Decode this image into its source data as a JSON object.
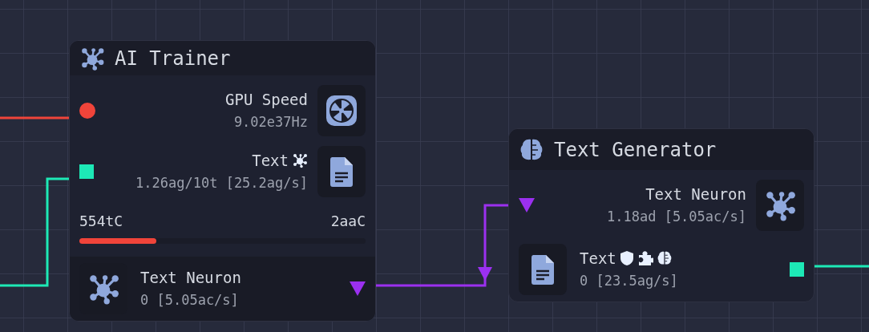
{
  "nodes": [
    {
      "kind": "trainer",
      "title": "AI Trainer",
      "rows": [
        {
          "kind": "gpu",
          "label": "GPU Speed",
          "value": "9.02e37Hz",
          "port": {
            "kind": "circle",
            "color": "#f0443a"
          }
        },
        {
          "kind": "text",
          "label": "Text",
          "value": "1.26ag/10t [25.2ag/s]",
          "port": {
            "kind": "square",
            "color": "#1de9b6"
          },
          "badges": [
            {
              "kind": "neuron"
            }
          ]
        }
      ],
      "progress": {
        "start": "554tC",
        "end": "2aaC",
        "level": 0.27
      },
      "outputs": [
        {
          "kind": "neuron",
          "label": "Text Neuron",
          "value": "0 [5.05ac/s]",
          "port": {
            "kind": "triangle",
            "color": "#9b30f0"
          }
        }
      ]
    },
    {
      "kind": "generator",
      "title": "Text Generator",
      "rows": [
        {
          "kind": "neuron",
          "label": "Text Neuron",
          "value": "1.18ad [5.05ac/s]",
          "port": {
            "kind": "triangle",
            "color": "#9b30f0"
          }
        }
      ],
      "outputs": [
        {
          "kind": "text",
          "label": "Text",
          "value": "0 [23.5ag/s]",
          "port": {
            "kind": "square",
            "color": "#1de9b6"
          },
          "badges": [
            {
              "kind": "shield"
            },
            {
              "kind": "puzzle"
            },
            {
              "kind": "brain"
            }
          ]
        }
      ]
    }
  ]
}
